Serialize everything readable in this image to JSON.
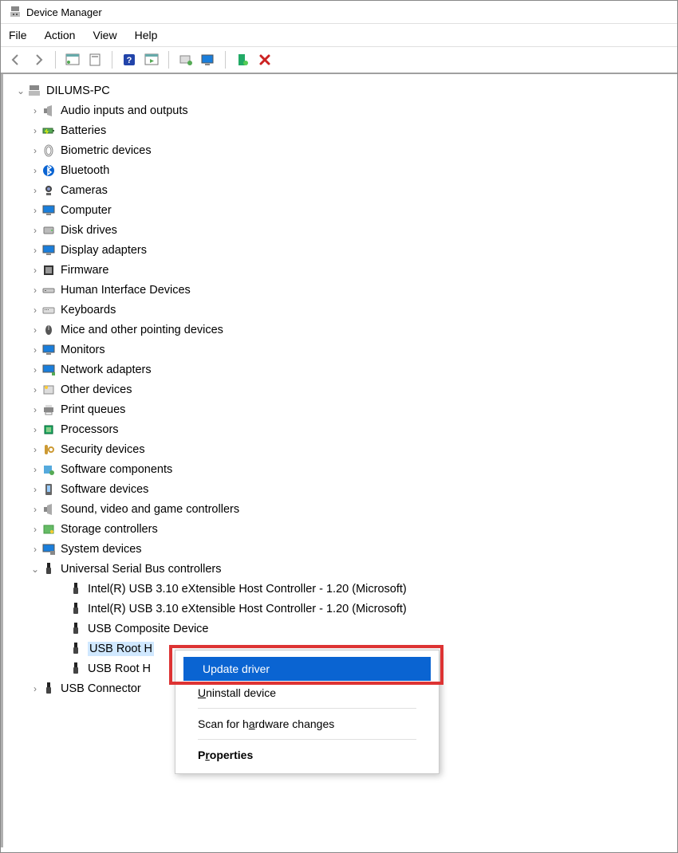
{
  "window": {
    "title": "Device Manager"
  },
  "menu": {
    "items": [
      "File",
      "Action",
      "View",
      "Help"
    ]
  },
  "toolbar": {
    "back": "back-icon",
    "forward": "forward-icon",
    "buttons": [
      "pane-icon",
      "clipboard-icon",
      "help-icon",
      "panel-icon",
      "scan-icon",
      "monitor-icon",
      "install-icon",
      "delete-icon"
    ]
  },
  "root": {
    "label": "DILUMS-PC",
    "children": [
      {
        "label": "Audio inputs and outputs",
        "icon": "audio"
      },
      {
        "label": "Batteries",
        "icon": "battery"
      },
      {
        "label": "Biometric devices",
        "icon": "biometric"
      },
      {
        "label": "Bluetooth",
        "icon": "bluetooth"
      },
      {
        "label": "Cameras",
        "icon": "camera"
      },
      {
        "label": "Computer",
        "icon": "computer"
      },
      {
        "label": "Disk drives",
        "icon": "disk"
      },
      {
        "label": "Display adapters",
        "icon": "display"
      },
      {
        "label": "Firmware",
        "icon": "firmware"
      },
      {
        "label": "Human Interface Devices",
        "icon": "hid"
      },
      {
        "label": "Keyboards",
        "icon": "keyboard"
      },
      {
        "label": "Mice and other pointing devices",
        "icon": "mouse"
      },
      {
        "label": "Monitors",
        "icon": "monitor"
      },
      {
        "label": "Network adapters",
        "icon": "network"
      },
      {
        "label": "Other devices",
        "icon": "other"
      },
      {
        "label": "Print queues",
        "icon": "printer"
      },
      {
        "label": "Processors",
        "icon": "cpu"
      },
      {
        "label": "Security devices",
        "icon": "security"
      },
      {
        "label": "Software components",
        "icon": "software-comp"
      },
      {
        "label": "Software devices",
        "icon": "software-dev"
      },
      {
        "label": "Sound, video and game controllers",
        "icon": "sound"
      },
      {
        "label": "Storage controllers",
        "icon": "storage"
      },
      {
        "label": "System devices",
        "icon": "system"
      }
    ]
  },
  "usb_category": {
    "label": "Universal Serial Bus controllers",
    "icon": "usb",
    "children": [
      {
        "label": "Intel(R) USB 3.10 eXtensible Host Controller - 1.20 (Microsoft)",
        "icon": "usb"
      },
      {
        "label": "Intel(R) USB 3.10 eXtensible Host Controller - 1.20 (Microsoft)",
        "icon": "usb"
      },
      {
        "label": "USB Composite Device",
        "icon": "usb"
      },
      {
        "label": "USB Root H",
        "icon": "usb",
        "selected": true
      },
      {
        "label": "USB Root H",
        "icon": "usb"
      }
    ]
  },
  "usb_connector": {
    "label": "USB Connector",
    "icon": "usb"
  },
  "context_menu": {
    "items": [
      {
        "label": "Update driver",
        "highlight": true
      },
      {
        "label": "Uninstall device",
        "accel": 0
      },
      {
        "sep": true
      },
      {
        "label": "Scan for hardware changes",
        "accel": 10
      },
      {
        "sep": true
      },
      {
        "label": "Properties",
        "accel": 1,
        "bold": true
      }
    ]
  }
}
